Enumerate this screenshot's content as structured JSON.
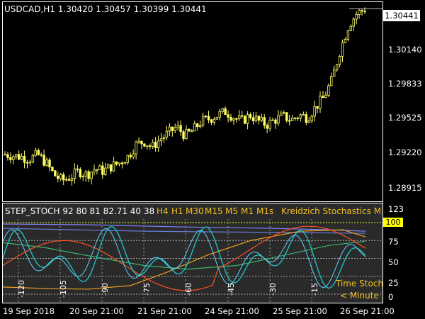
{
  "main_chart": {
    "title": "USDCAD,H1  1.30420 1.30457 1.30399 1.30441",
    "price_labels": [
      "1.30441",
      "1.30140",
      "1.29833",
      "1.29525",
      "1.29220",
      "1.28915"
    ],
    "current_price": "1.30441",
    "candle_color": "#ffff66"
  },
  "indicator": {
    "name": "STEP_STOCH 92 80 81 82.71 40 38",
    "timeframes": [
      "H4",
      "H1",
      "M30",
      "M15",
      "M5",
      "M1",
      "M1s"
    ],
    "timeframe_colors": [
      "#8080ff",
      "#6a7bd6",
      "#3cb371",
      "#f0a020",
      "#ff5020",
      "#20c0c0",
      "#60d0ff"
    ],
    "title_right": "Kreidzich Stochastics  M",
    "levels": [
      "123",
      "100",
      "75",
      "50",
      "25",
      "0"
    ],
    "current_level": "100",
    "minute_markers": [
      "-120",
      "-105",
      "-90",
      "-75",
      "-60",
      "-45",
      "-30",
      "-15"
    ],
    "note_line1": "Time Stoch",
    "note_line2": "< Minute"
  },
  "time_axis": [
    "19 Sep 2018",
    "20 Sep 21:00",
    "21 Sep 21:00",
    "24 Sep 21:00",
    "25 Sep 21:00",
    "26 Sep 21:00"
  ],
  "chart_data": {
    "type": "candlestick",
    "symbol": "USDCAD",
    "timeframe": "H1",
    "ohlc_last": {
      "open": 1.3042,
      "high": 1.30457,
      "low": 1.30399,
      "close": 1.30441
    },
    "ylim": [
      1.2885,
      1.3048
    ],
    "closes_approx": [
      1.2922,
      1.2921,
      1.292,
      1.2918,
      1.2922,
      1.2915,
      1.2905,
      1.29,
      1.2903,
      1.2908,
      1.2905,
      1.291,
      1.2908,
      1.2912,
      1.2915,
      1.292,
      1.293,
      1.2933,
      1.2928,
      1.2935,
      1.294,
      1.2945,
      1.2938,
      1.2942,
      1.295,
      1.2952,
      1.2955,
      1.2958,
      1.2953,
      1.295,
      1.2955,
      1.295,
      1.2947,
      1.2951,
      1.2954,
      1.2951,
      1.2955,
      1.2953,
      1.2962,
      1.297,
      1.2985,
      1.301,
      1.303,
      1.304,
      1.3044
    ]
  }
}
